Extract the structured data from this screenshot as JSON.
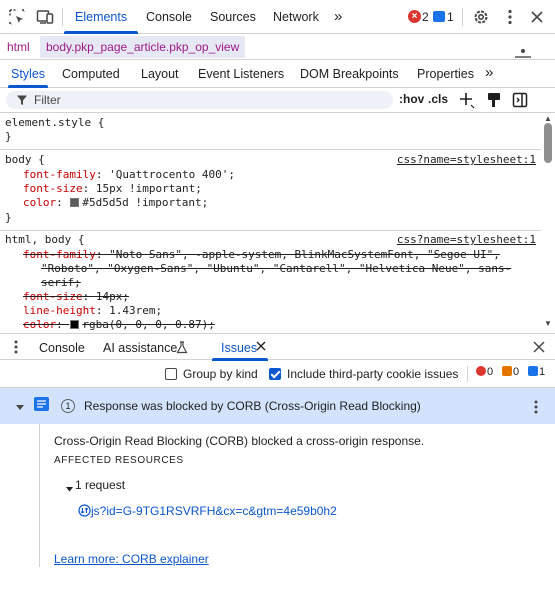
{
  "toolbar": {
    "tabs": [
      "Elements",
      "Console",
      "Sources",
      "Network"
    ],
    "more_tabs": "»",
    "error_count": "2",
    "info_count": "1"
  },
  "breadcrumb": [
    "html",
    "body.pkp_page_article.pkp_op_view"
  ],
  "subtabs": [
    "Styles",
    "Computed",
    "Layout",
    "Event Listeners",
    "DOM Breakpoints",
    "Properties",
    "»"
  ],
  "filter": {
    "placeholder": "Filter",
    "hov": ":hov",
    "cls": ".cls"
  },
  "styles": {
    "element_style": {
      "selector": "element.style {",
      "close": "}"
    },
    "rule1": {
      "selector": "body {",
      "source": "css?name=stylesheet:1",
      "props": [
        {
          "name": "font-family",
          "value": "'Quattrocento 400';"
        },
        {
          "name": "font-size",
          "value": "15px !important;"
        },
        {
          "name": "color",
          "value": "#5d5d5d !important;",
          "swatch": "#5d5d5d"
        }
      ],
      "close": "}"
    },
    "rule2": {
      "selector": "html, body {",
      "source": "css?name=stylesheet:1",
      "lines": [
        {
          "name": "font-family",
          "value": "\"Noto Sans\", -apple-system, BlinkMacSystemFont, \"Segoe UI\",",
          "strike": true
        },
        {
          "name": "",
          "value": "\"Roboto\", \"Oxygen-Sans\", \"Ubuntu\", \"Cantarell\", \"Helvetica Neue\", sans-",
          "strike": true
        },
        {
          "name": "",
          "value": "serif;",
          "strike": true
        },
        {
          "name": "font-size",
          "value": "14px;",
          "strike": true
        },
        {
          "name": "line-height",
          "value": "1.43rem;",
          "strike": false
        },
        {
          "name": "color",
          "value": "rgba(0, 0, 0, 0.87);",
          "strike": true,
          "swatch": "#000000"
        }
      ]
    }
  },
  "drawer": {
    "tabs": [
      "Console",
      "AI assistance",
      "Issues"
    ],
    "issues_toolbar": {
      "group_by_kind": "Group by kind",
      "group_by_kind_checked": false,
      "third_party": "Include third-party cookie issues",
      "third_party_checked": true,
      "counts": {
        "errors": "0",
        "warnings": "0",
        "info": "1"
      }
    },
    "issue": {
      "count": "1",
      "title": "Response was blocked by CORB (Cross-Origin Read Blocking)",
      "description": "Cross-Origin Read Blocking (CORB) blocked a cross-origin response.",
      "affected_heading": "AFFECTED RESOURCES",
      "request_toggle": "1 request",
      "resource": "js?id=G-9TG1RSVRFH&cx=c&gtm=4e59b0h2",
      "learn_more": "Learn more: CORB explainer"
    }
  },
  "colors": {
    "accent": "#0b57d0",
    "selected_row": "#d3e3fd",
    "property": "#c80000",
    "error": "#dc362e"
  }
}
